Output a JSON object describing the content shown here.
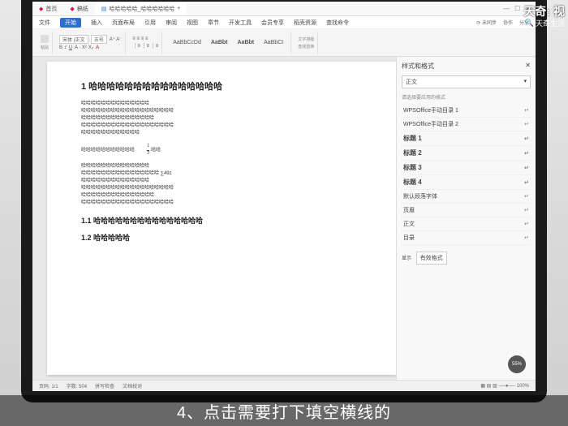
{
  "watermark": {
    "top": "天奇: 视",
    "sub": "天奇生活"
  },
  "subtitle": "4、点击需要打下填空横线的",
  "tabs": {
    "home": "首页",
    "doc1": "稿纸",
    "doc2": "哈哈哈哈哈_哈哈哈哈哈哈"
  },
  "menu": {
    "file": "文件",
    "start": "开始",
    "insert": "插入",
    "layout": "页面布局",
    "ref": "引用",
    "review": "审阅",
    "view": "视图",
    "section": "章节",
    "dev": "开发工具",
    "member": "会员专享",
    "template": "稻壳资源",
    "search": "查找命令"
  },
  "topright": {
    "sync": "未同步",
    "coop": "协作",
    "share": "分享"
  },
  "ribbon": {
    "paste": "粘贴",
    "fmt": "格式刷",
    "font": "宋体 (正文",
    "size": "五号",
    "styles": {
      "s1": "AaBbCcDd",
      "s2": "AaBbt",
      "s3": "AaBbt",
      "s4": "AaBbCt"
    },
    "find": "查找替换",
    "select": "选择",
    "tools": "文字排版"
  },
  "doc": {
    "h1": "1 哈哈哈哈哈哈哈哈哈哈哈哈哈哈哈",
    "body1": "哈哈哈哈哈哈哈哈哈哈哈哈哈哈\n哈哈哈哈哈哈哈哈哈哈哈哈哈哈哈哈哈哈哈\n哈哈哈哈哈哈哈哈哈哈哈哈哈哈哈\n哈哈哈哈哈哈哈哈哈哈哈哈哈哈哈哈哈哈哈\n哈哈哈哈哈哈哈哈哈哈哈哈",
    "frac_line": "哈哈哈哈哈哈哈哈哈哈哈",
    "frac_after": "哈哈",
    "body2": "哈哈哈哈哈哈哈哈哈哈哈哈哈哈\n哈哈哈哈哈哈哈哈哈哈哈哈哈哈哈哈 ∑49z\n哈哈哈哈哈哈哈哈哈哈哈哈哈哈\n哈哈哈哈哈哈哈哈哈哈哈哈哈哈哈哈哈哈哈\n哈哈哈哈哈哈哈哈哈哈哈哈哈哈哈\n哈哈哈哈哈哈哈哈哈哈哈哈哈哈哈哈哈哈哈",
    "h11": "1.1 哈哈哈哈哈哈哈哈哈哈哈哈哈哈哈",
    "h12": "1.2 哈哈哈哈哈"
  },
  "panel": {
    "title": "样式和格式",
    "current": "正文",
    "sectitle": "请选择要应用的格式",
    "items": [
      {
        "label": "WPSOffice手动目录 1",
        "bold": false
      },
      {
        "label": "WPSOffice手动目录 2",
        "bold": false
      },
      {
        "label": "标题 1",
        "bold": true
      },
      {
        "label": "标题 2",
        "bold": true
      },
      {
        "label": "标题 3",
        "bold": true
      },
      {
        "label": "标题 4",
        "bold": true
      },
      {
        "label": "默认段落字体",
        "bold": false
      },
      {
        "label": "页眉",
        "bold": false
      },
      {
        "label": "正文",
        "bold": false
      },
      {
        "label": "目录",
        "bold": false
      }
    ],
    "showlabel": "显示",
    "showval": "有效格式"
  },
  "status": {
    "page": "页码: 1/1",
    "words": "字数: 504",
    "spell": "拼写检查",
    "docfix": "文档校对"
  },
  "fab": "55%"
}
